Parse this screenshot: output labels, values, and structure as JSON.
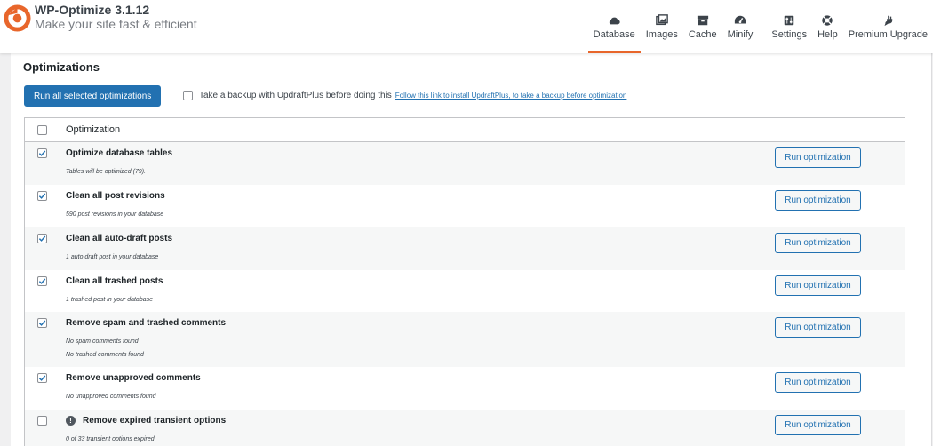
{
  "brand": {
    "title": "WP-Optimize 3.1.12",
    "tagline": "Make your site fast & efficient",
    "logo_color": "#e8662b"
  },
  "nav": {
    "active_color": "#e8662b",
    "items": [
      {
        "label": "Database",
        "icon": "cloud-icon",
        "active": true
      },
      {
        "label": "Images",
        "icon": "images-icon",
        "active": false
      },
      {
        "label": "Cache",
        "icon": "archive-icon",
        "active": false
      },
      {
        "label": "Minify",
        "icon": "dashboard-gauge-icon",
        "active": false
      },
      {
        "label": "Settings",
        "icon": "settings-icon",
        "active": false
      },
      {
        "label": "Help",
        "icon": "lifebuoy-icon",
        "active": false
      },
      {
        "label": "Premium Upgrade",
        "icon": "plug-icon",
        "active": false
      }
    ]
  },
  "main": {
    "heading": "Optimizations",
    "run_all_label": "Run all selected optimizations",
    "backup_label": "Take a backup with UpdraftPlus before doing this",
    "backup_link": "Follow this link to install UpdraftPlus, to take a backup before optimization",
    "backup_checked": false,
    "primary_color": "#2271b1"
  },
  "table": {
    "header": "Optimization",
    "header_checked": false,
    "rows": [
      {
        "title": "Optimize database tables",
        "desc": [
          "Tables will be optimized (79)."
        ],
        "checked": true,
        "info": false,
        "button": "Run optimization"
      },
      {
        "title": "Clean all post revisions",
        "desc": [
          "590 post revisions in your database"
        ],
        "checked": true,
        "info": false,
        "button": "Run optimization"
      },
      {
        "title": "Clean all auto-draft posts",
        "desc": [
          "1 auto draft post in your database"
        ],
        "checked": true,
        "info": false,
        "button": "Run optimization"
      },
      {
        "title": "Clean all trashed posts",
        "desc": [
          "1 trashed post in your database"
        ],
        "checked": true,
        "info": false,
        "button": "Run optimization"
      },
      {
        "title": "Remove spam and trashed comments",
        "desc": [
          "No spam comments found",
          "No trashed comments found"
        ],
        "checked": true,
        "info": false,
        "button": "Run optimization"
      },
      {
        "title": "Remove unapproved comments",
        "desc": [
          "No unapproved comments found"
        ],
        "checked": true,
        "info": false,
        "button": "Run optimization"
      },
      {
        "title": "Remove expired transient options",
        "desc": [
          "0 of 33 transient options expired"
        ],
        "checked": false,
        "info": true,
        "info_glyph": "!",
        "button": "Run optimization"
      }
    ]
  }
}
